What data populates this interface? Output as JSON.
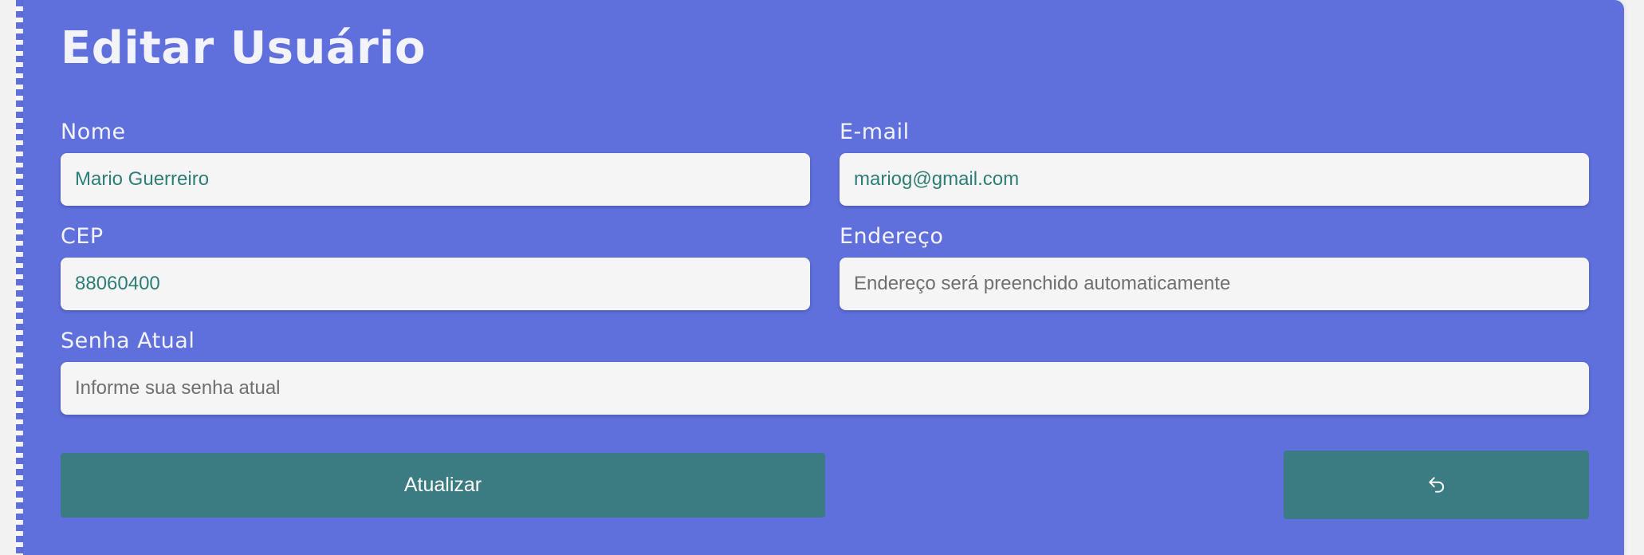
{
  "page": {
    "title": "Editar Usuário"
  },
  "form": {
    "nome": {
      "label": "Nome",
      "value": "Mario Guerreiro",
      "placeholder": ""
    },
    "email": {
      "label": "E-mail",
      "value": "mariog@gmail.com",
      "placeholder": ""
    },
    "cep": {
      "label": "CEP",
      "value": "88060400",
      "placeholder": ""
    },
    "endereco": {
      "label": "Endereço",
      "value": "",
      "placeholder": "Endereço será preenchido automaticamente"
    },
    "senha_atual": {
      "label": "Senha Atual",
      "value": "",
      "placeholder": "Informe sua senha atual"
    }
  },
  "actions": {
    "update_label": "Atualizar",
    "back_icon": "undo-arrow-icon"
  },
  "colors": {
    "card_background": "#5f6fdb",
    "button_background": "#3a7c82",
    "input_text": "#2e7d76",
    "input_background": "#f5f5f5"
  }
}
